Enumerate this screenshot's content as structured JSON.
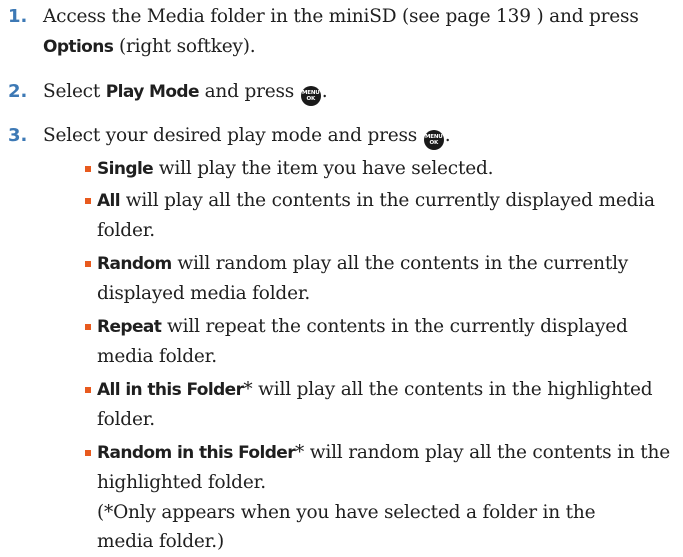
{
  "accent_colors": {
    "step_number": "#3d79b5",
    "bullet": "#e85a1e"
  },
  "icons": {
    "menu_ok_key": "menu-ok-key-icon"
  },
  "menu_key": {
    "top": "MENU",
    "bottom": "OK"
  },
  "steps": [
    {
      "number": "1.",
      "line1": "Access the Media folder in the miniSD (see page 139 ) and press",
      "bold": "Options",
      "line2_rest": " (right softkey)."
    },
    {
      "number": "2.",
      "pre": "Select ",
      "bold": "Play Mode",
      "post": " and press ",
      "end": "."
    },
    {
      "number": "3.",
      "pre": "Select your desired play mode and press ",
      "end": "."
    }
  ],
  "options": [
    {
      "term": "Single",
      "line1": " will play the item you have selected."
    },
    {
      "term": "All",
      "line1": " will play all the contents in the currently displayed media",
      "line2": "folder."
    },
    {
      "term": "Random",
      "line1": " will random play all the contents in the currently",
      "line2": "displayed media folder."
    },
    {
      "term": "Repeat",
      "line1": " will repeat the contents in the currently displayed",
      "line2": "media folder."
    },
    {
      "term": "All in this Folder",
      "line1": "* will play all the contents in the highlighted",
      "line2": "folder."
    },
    {
      "term": "Random in this Folder",
      "line1": "* will random play all the contents in the",
      "line2": "highlighted folder."
    }
  ],
  "note": {
    "line1": "(*Only appears when you have selected a folder in the",
    "line2": "media folder.)"
  }
}
